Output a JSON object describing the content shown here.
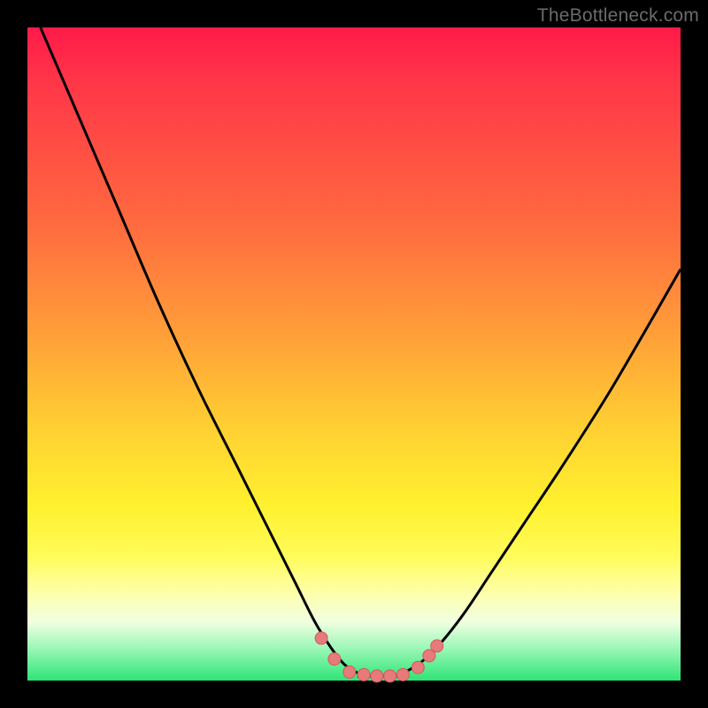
{
  "watermark": "TheBottleneck.com",
  "colors": {
    "frame": "#000000",
    "curve": "#000000",
    "marker_fill": "#e77a7b",
    "marker_stroke": "#d35a5c",
    "gradient_stops": [
      "#ff1a49",
      "#ff3548",
      "#ff6a3f",
      "#ffa238",
      "#ffd232",
      "#fff02e",
      "#fffc5a",
      "#fdffb0",
      "#f0ffe0",
      "#9df7b8",
      "#2de575"
    ]
  },
  "chart_data": {
    "type": "line",
    "title": "",
    "xlabel": "",
    "ylabel": "",
    "xlim": [
      0,
      100
    ],
    "ylim": [
      0,
      100
    ],
    "series": [
      {
        "name": "left-curve",
        "x": [
          2,
          8,
          14,
          20,
          26,
          32,
          37,
          41,
          44,
          46.5,
          48.5,
          50.5,
          52.5
        ],
        "y": [
          100,
          86,
          72,
          58,
          45,
          33,
          23,
          15,
          9,
          5,
          2.5,
          1.2,
          0.7
        ]
      },
      {
        "name": "right-curve",
        "x": [
          56,
          58,
          60.5,
          63.5,
          67,
          71,
          76,
          82,
          89,
          96,
          100
        ],
        "y": [
          0.7,
          1.4,
          3,
          6,
          10.5,
          16.5,
          24,
          33,
          44,
          56,
          63
        ]
      }
    ],
    "flat_segment": {
      "x": [
        50.5,
        57.5
      ],
      "y": 0.7
    },
    "markers": [
      {
        "x": 45.0,
        "y": 6.5
      },
      {
        "x": 47.0,
        "y": 3.3
      },
      {
        "x": 49.3,
        "y": 1.3
      },
      {
        "x": 51.5,
        "y": 0.9
      },
      {
        "x": 53.5,
        "y": 0.7
      },
      {
        "x": 55.5,
        "y": 0.7
      },
      {
        "x": 57.5,
        "y": 0.9
      },
      {
        "x": 59.8,
        "y": 2.0
      },
      {
        "x": 61.5,
        "y": 3.8
      },
      {
        "x": 62.7,
        "y": 5.3
      }
    ]
  }
}
